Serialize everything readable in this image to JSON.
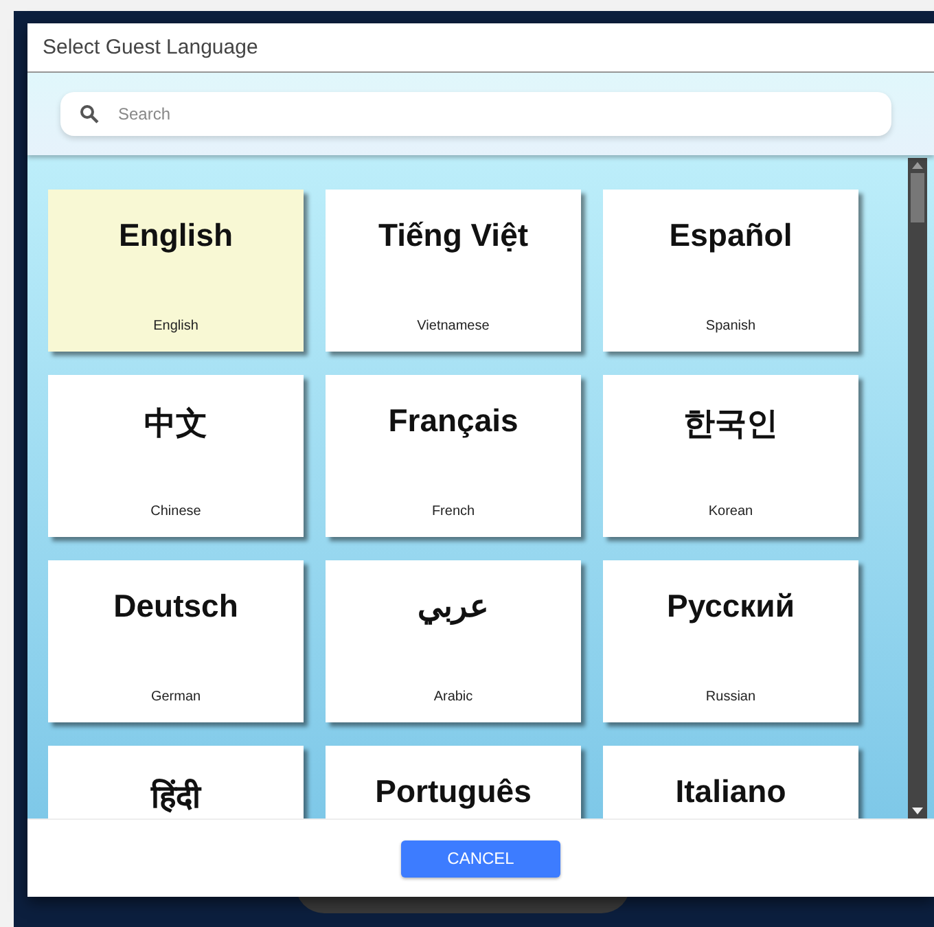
{
  "dialog": {
    "title": "Select Guest Language"
  },
  "search": {
    "placeholder": "Search"
  },
  "languages": [
    {
      "native": "English",
      "english": "English",
      "selected": true
    },
    {
      "native": "Tiếng Việt",
      "english": "Vietnamese",
      "selected": false
    },
    {
      "native": "Español",
      "english": "Spanish",
      "selected": false
    },
    {
      "native": "中文",
      "english": "Chinese",
      "selected": false
    },
    {
      "native": "Français",
      "english": "French",
      "selected": false
    },
    {
      "native": "한국인",
      "english": "Korean",
      "selected": false
    },
    {
      "native": "Deutsch",
      "english": "German",
      "selected": false
    },
    {
      "native": "عربي",
      "english": "Arabic",
      "selected": false
    },
    {
      "native": "Русский",
      "english": "Russian",
      "selected": false
    },
    {
      "native": "हिंदी",
      "selected": false
    },
    {
      "native": "Português",
      "selected": false
    },
    {
      "native": "Italiano",
      "selected": false
    }
  ],
  "buttons": [
    "CANCEL"
  ]
}
